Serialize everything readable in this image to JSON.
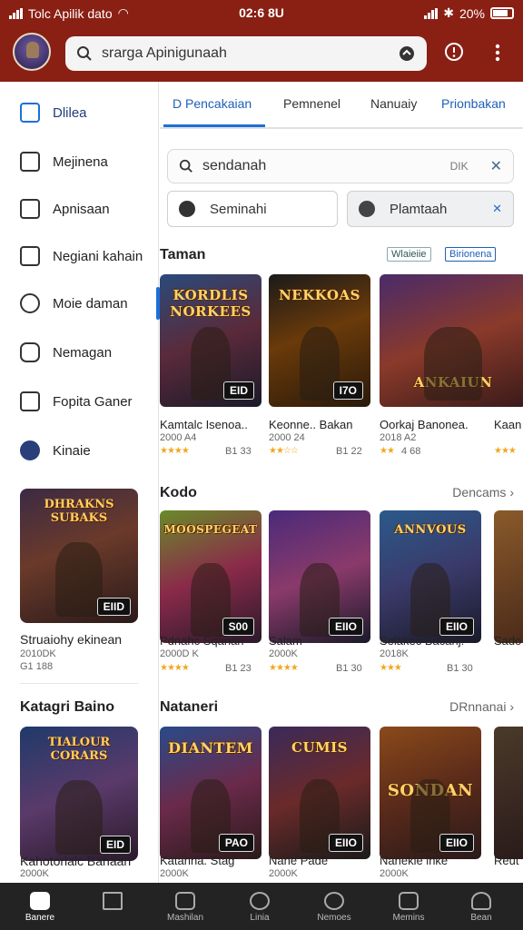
{
  "status": {
    "left_text": "Tolc Apilik dato",
    "time": "02:6 8U",
    "battery": "20%"
  },
  "header": {
    "search_text": "srarga Apinigunaah"
  },
  "sidebar": {
    "items": [
      {
        "label": "Dlilea"
      },
      {
        "label": "Mejinena"
      },
      {
        "label": "Apnisaan"
      },
      {
        "label": "Negiani kahain"
      },
      {
        "label": "Moie daman"
      },
      {
        "label": "Nemagan"
      },
      {
        "label": "Fopita Ganer"
      },
      {
        "label": "Kinaie"
      }
    ],
    "feature": {
      "art": "DHRAKNS SUBAKS",
      "tag": "EIID",
      "title": "Struaiohy ekinean",
      "sub1": "2010DK",
      "sub2": "G1 188"
    },
    "heading": "Katagri Baino",
    "feature2": {
      "art": "TIALOUR CORARS",
      "tag": "EID",
      "title": "Kahotorlalc Bahaan",
      "sub1": "2000K"
    }
  },
  "tabs": [
    "D Pencakaian",
    "Pemnenel",
    "Nanuaiy",
    "Prionbakan"
  ],
  "subsearch": {
    "text": "sendanah",
    "extra": "DIK"
  },
  "chips": [
    {
      "label": "Seminahi"
    },
    {
      "label": "Plamtaah"
    }
  ],
  "sections": [
    {
      "title": "Taman",
      "filters": [
        "Wlaieiie",
        "Birionena"
      ],
      "games": [
        {
          "art": "KORDLIS NORKEES",
          "tag": "EID",
          "name": "Kamtalc Isenoa..",
          "sub": "2000 A4",
          "rating": "★★★★",
          "size": "B1 33"
        },
        {
          "art": "NEKKOAS",
          "tag": "I7O",
          "name": "Keonne.. Bakan",
          "sub": "2000 24",
          "rating": "★★☆☆",
          "size": "B1 22"
        },
        {
          "art": "ANKAIUN",
          "tag": "",
          "name": "Oorkaj Banonea.",
          "sub": "2018 A2",
          "rating": "★★",
          "size": "4 68"
        },
        {
          "art": "",
          "tag": "",
          "name": "Kaan",
          "sub": "",
          "rating": "★★★",
          "size": ""
        }
      ]
    },
    {
      "title": "Kodo",
      "more": "Dencams",
      "games": [
        {
          "art": "MOOSPEGEAT",
          "tag": "S00",
          "name": "Pdnahc Sqanan",
          "sub": "2000D K",
          "rating": "★★★★",
          "size": "B1 23"
        },
        {
          "art": "",
          "tag": "EIIO",
          "name": "Salam",
          "sub": "2000K",
          "rating": "★★★★",
          "size": "B1 30"
        },
        {
          "art": "ANNVOUS",
          "tag": "EIIO",
          "name": "Selakec Bacanj.",
          "sub": "2018K",
          "rating": "★★★",
          "size": "B1 30"
        },
        {
          "art": "",
          "tag": "",
          "name": "Sado",
          "sub": "",
          "rating": "",
          "size": ""
        }
      ]
    },
    {
      "title": "Nataneri",
      "more": "DRnnanai",
      "games": [
        {
          "art": "DIANTEM",
          "tag": "PAO",
          "name": "Katanna. Stag",
          "sub": "2000K",
          "rating": "",
          "size": ""
        },
        {
          "art": "CUMIS",
          "tag": "EIIO",
          "name": "Nane Pade",
          "sub": "2000K",
          "rating": "",
          "size": ""
        },
        {
          "art": "SONDAN",
          "tag": "EIIO",
          "name": "Nanekie ihke",
          "sub": "2000K",
          "rating": "",
          "size": ""
        },
        {
          "art": "",
          "tag": "",
          "name": "Reut",
          "sub": "",
          "rating": "",
          "size": ""
        }
      ]
    }
  ],
  "bottomnav": [
    "Banere",
    "",
    "Mashilan",
    "Linia",
    "Nemoes",
    "Memins",
    "Bean"
  ]
}
